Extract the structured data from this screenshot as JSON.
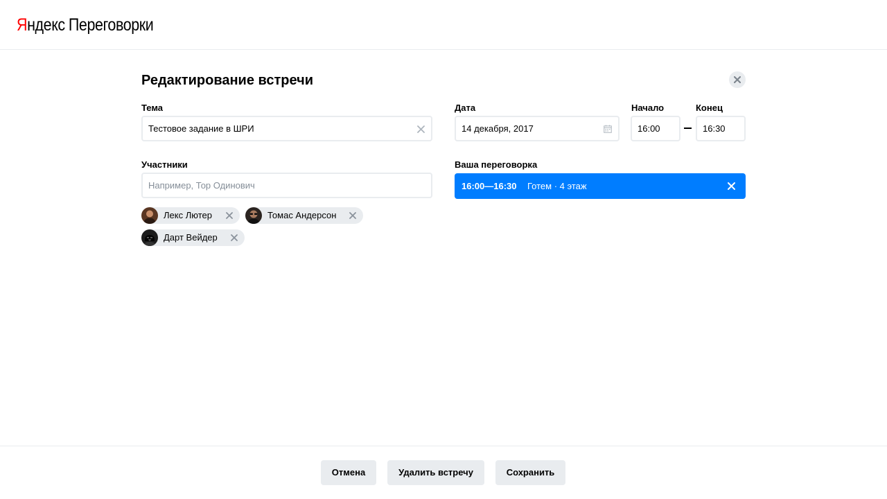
{
  "app": {
    "brand_first": "Я",
    "brand_rest": "ндекс",
    "product": "Переговорки"
  },
  "page": {
    "title": "Редактирование встречи"
  },
  "form": {
    "topic": {
      "label": "Тема",
      "value": "Тестовое задание в ШРИ"
    },
    "date": {
      "label": "Дата",
      "value": "14 декабря, 2017"
    },
    "start": {
      "label": "Начало",
      "value": "16:00"
    },
    "end": {
      "label": "Конец",
      "value": "16:30"
    },
    "participants": {
      "label": "Участники",
      "placeholder": "Например, Тор Одинович",
      "items": [
        {
          "name": "Лекс Лютер"
        },
        {
          "name": "Томас Андерсон"
        },
        {
          "name": "Дарт Вейдер"
        }
      ]
    },
    "room": {
      "label": "Ваша переговорка",
      "time": "16:00—16:30",
      "name": "Готем · 4 этаж"
    }
  },
  "footer": {
    "cancel_label": "Отмена",
    "delete_label": "Удалить встречу",
    "save_label": "Сохранить"
  },
  "colors": {
    "accent": "#007dff",
    "brand_red": "#ff0000",
    "chip_bg": "#e9ecef",
    "placeholder": "#858e98"
  },
  "icons": {
    "close": "close-icon",
    "clear": "clear-icon",
    "calendar": "calendar-icon",
    "remove": "remove-icon"
  }
}
